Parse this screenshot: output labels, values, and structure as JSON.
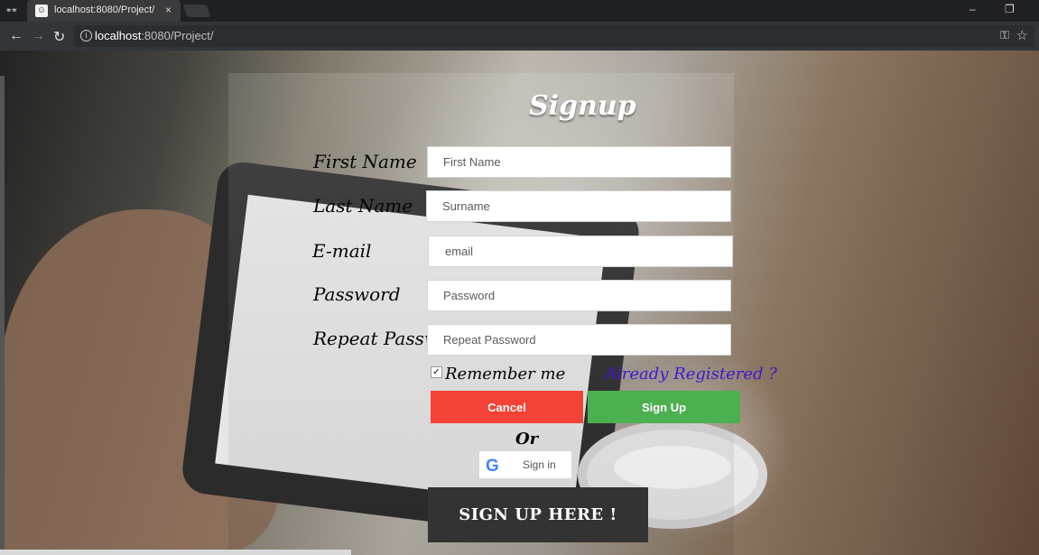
{
  "browser": {
    "tab": {
      "title": "localhost:8080/Project/",
      "favicon": "tab-favicon-icon",
      "close": "×"
    },
    "window": {
      "minimize": "–",
      "restore": "❐"
    },
    "address": {
      "host": "localhost",
      "path": ":8080/Project/"
    },
    "icons": {
      "incognito": "👓",
      "back": "←",
      "forward": "→",
      "reload": "↻",
      "info": "i",
      "key": "⚿",
      "star": "☆"
    }
  },
  "form": {
    "title": "Signup",
    "labels": {
      "first_name": "First Name",
      "last_name": "Last Name",
      "email": "E-mail",
      "password": "Password",
      "repeat_password": "Repeat Password"
    },
    "placeholders": {
      "first_name": "First Name",
      "last_name": "Surname",
      "email": "email",
      "password": "Password",
      "repeat_password": "Repeat Password"
    },
    "remember_me": "Remember me",
    "remember_checked": true,
    "check_mark": "✓",
    "already_registered": "Already Registered ?",
    "cancel": "Cancel",
    "sign_up": "Sign Up",
    "or": "Or",
    "google_sign_in": "Sign in",
    "google_icon": "G",
    "sign_up_here": "SIGN UP HERE !"
  },
  "colors": {
    "cancel": "#f44336",
    "sign_up": "#4caf50",
    "link": "#3f19d8",
    "sign_up_here": "#333333"
  }
}
